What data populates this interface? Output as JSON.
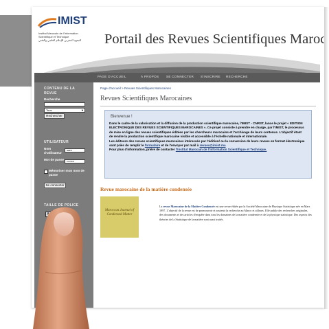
{
  "header": {
    "logo_text": "IMIST",
    "logo_sub": "Institut Marocain de l'Information Scientifique et Technique",
    "logo_sub_ar": "المعهد المغربي للإعلام العلمي والتقني",
    "portal_title": "Portail des Revues Scientifiques Marocaines"
  },
  "nav": {
    "items": [
      "PAGE D'ACCUEIL",
      "À PROPOS",
      "SE CONNECTER",
      "S'INSCRIRE",
      "RECHERCHE"
    ]
  },
  "sidebar": {
    "content_heading": "CONTENU DE LA REVUE",
    "search_label": "Recherche",
    "search_value": "",
    "scope_value": "Tous",
    "search_button": "Rechercher",
    "user_heading": "UTILISATEUR",
    "username_label": "Nom d'utilisateur",
    "username_value": "saro",
    "password_label": "Mot de passe",
    "password_value": "••••••••",
    "remember_label": "Mémoriser mon nom de passe",
    "login_button": "Se connecter",
    "font_size_heading": "TAILLE DE POLICE"
  },
  "main": {
    "breadcrumb": "Page d'accueil > Revues Scientifiques Marocaines",
    "title": "Revues Scientifiques Marocaines",
    "welcome_title": "Bienvenue !",
    "welcome_p1": "Dans le cadre de la valorisation et la diffusion de la production scientifique marocaine, l'IMIST - CNRST, lance le projet « EDITION ELECTRONIQUE DES REVUES SCIENTIFIQUES MAROCAINES ». Ce projet consiste à prendre en charge, par l'IMIST, le processus de mise en ligne des revues scientifiques éditées par les chercheurs marocains et l'archivage de leurs contenus. L'objectif étant de rendre la production scientifique marocaine visible et accessible à l'échelle nationale et internationale.",
    "welcome_p2_a": "Les éditeurs des revues scientifiques marocaines intéressés par l'édition/ ou la conversion de leurs revues en format électronique sont priés de remplir le ",
    "welcome_p2_link": "formulaire",
    "welcome_p2_b": " et de l'envoyer par mail à ",
    "welcome_p2_mail": "revues@imist.ma",
    "welcome_p3_a": "Pour plus d'information, prière de contacter ",
    "welcome_p3_link": "l'Institut Marocain de l'Information Scientifique et Technique.",
    "section_title": "Revue marocaine de la matière condensée",
    "cover_text": "Moroccan Journal of Condensed Matter",
    "journal_a": "La ",
    "journal_name": "revue Marocaine de la Matière Condensée",
    "journal_b": " est une revue éditée par la Société Marocaine de Physique Statistique née en Mars 1997. L'objectif de la revue est de promouvoir et soutenir la recherche au Maroc et ailleurs. Elle publie des recherches originales, des documents et des articles d'enquête dans tous les domaines de la matière condensée et de la physique statistique. Des aspects des théories de la Statistique de la matière sont aussi traités."
  },
  "colors": {
    "accent_orange": "#c86b1b",
    "link_blue": "#1e3f7a",
    "sidebar_gray": "#7c7c7c",
    "welcome_bg": "#dde6f2"
  }
}
